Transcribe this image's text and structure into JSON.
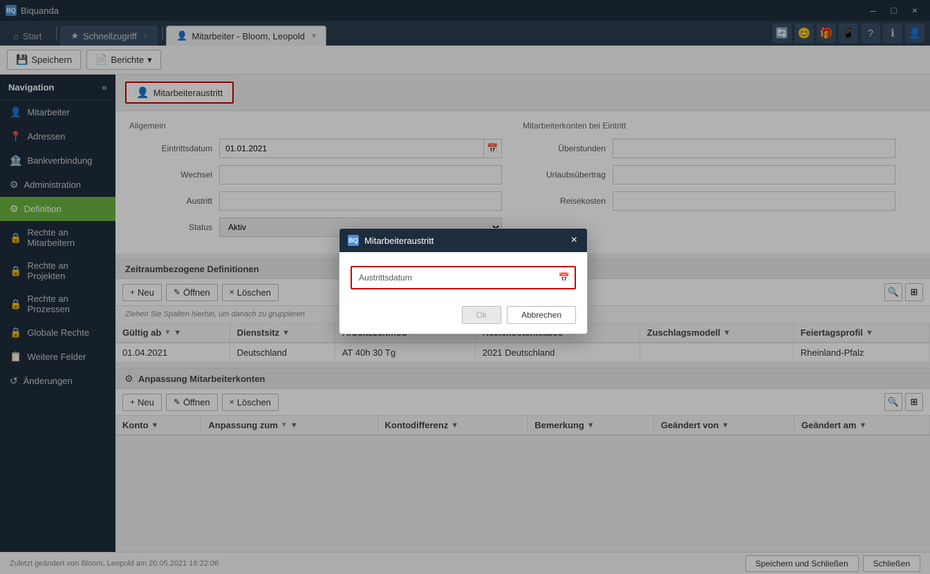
{
  "app": {
    "name": "Biquanda"
  },
  "titlebar": {
    "title": "Biquanda",
    "min": "–",
    "max": "□",
    "close": "×"
  },
  "tabs": [
    {
      "id": "start",
      "label": "Start",
      "icon": "⌂",
      "active": false,
      "pinned": false,
      "closable": false
    },
    {
      "id": "schnellzugriff",
      "label": "Schnellzugriff",
      "icon": "★",
      "active": false,
      "pinned": true,
      "closable": false
    },
    {
      "id": "mitarbeiter",
      "label": "Mitarbeiter - Bloom, Leopold",
      "icon": "👤",
      "active": true,
      "pinned": false,
      "closable": true
    }
  ],
  "toolbar": {
    "save_label": "Speichern",
    "reports_label": "Berichte"
  },
  "sidebar": {
    "title": "Navigation",
    "items": [
      {
        "id": "mitarbeiter",
        "label": "Mitarbeiter",
        "icon": "👤",
        "active": false
      },
      {
        "id": "adressen",
        "label": "Adressen",
        "icon": "📍",
        "active": false
      },
      {
        "id": "bankverbindung",
        "label": "Bankverbindung",
        "icon": "🏦",
        "active": false
      },
      {
        "id": "administration",
        "label": "Administration",
        "icon": "⚙",
        "active": false
      },
      {
        "id": "definition",
        "label": "Definition",
        "icon": "⚙",
        "active": true
      },
      {
        "id": "rechte-mitarbeiter",
        "label": "Rechte an Mitarbeitern",
        "icon": "🔒",
        "active": false
      },
      {
        "id": "rechte-projekte",
        "label": "Rechte an Projekten",
        "icon": "🔒",
        "active": false
      },
      {
        "id": "rechte-prozessen",
        "label": "Rechte an Prozessen",
        "icon": "🔒",
        "active": false
      },
      {
        "id": "globale-rechte",
        "label": "Globale Rechte",
        "icon": "🔒",
        "active": false
      },
      {
        "id": "weitere-felder",
        "label": "Weitere Felder",
        "icon": "📋",
        "active": false
      },
      {
        "id": "aenderungen",
        "label": "Änderungen",
        "icon": "↺",
        "active": false
      }
    ]
  },
  "content": {
    "action_button": "Mitarbeiteraustritt",
    "general_title": "Allgemein",
    "employee_accounts_title": "Mitarbeiterkonten bei Eintritt",
    "fields": {
      "eintrittsdatum_label": "Eintrittsdatum",
      "eintrittsdatum_value": "01.01.2021",
      "wechsel_label": "Wechsel",
      "austritt_label": "Austritt",
      "status_label": "Status",
      "status_value": "Aktiv",
      "ueberstunden_label": "Überstunden",
      "urlaubsuebertrag_label": "Urlaubsübertrag",
      "reisekosten_label": "Reisekosten"
    },
    "zeitraum_title": "Zeitraumbezogene Definitionen",
    "table_buttons": {
      "neu": "+ Neu",
      "oeffnen": "Öffnen",
      "loeschen": "Löschen"
    },
    "group_hint": "Ziehen Sie Spalten hierhin, um danach zu gruppieren",
    "table_columns": [
      {
        "label": "Gültig ab",
        "sortable": true,
        "filter": true
      },
      {
        "label": "Dienstsitz",
        "sortable": false,
        "filter": true
      },
      {
        "label": "Arbeitszeitmod",
        "sortable": false,
        "filter": true
      },
      {
        "label": "Resiekostenklasse",
        "sortable": false,
        "filter": true
      },
      {
        "label": "Zuschlagsmodell",
        "sortable": false,
        "filter": true
      },
      {
        "label": "Feiertagsprofil",
        "sortable": false,
        "filter": true
      }
    ],
    "table_rows": [
      {
        "gueltig_ab": "01.04.2021",
        "dienstsitz": "Deutschland",
        "arbeitszeitmod": "AT 40h 30 Tg",
        "reisekostenklasse": "2021 Deutschland",
        "zuschlagsmodell": "",
        "feiertagsprofil": "Rheinland-Pfalz"
      }
    ],
    "anpassung_title": "Anpassung Mitarbeiterkonten",
    "anpassung_columns": [
      {
        "label": "Konto",
        "filter": true
      },
      {
        "label": "Anpassung zum",
        "filter": true
      },
      {
        "label": "Kontodifferenz",
        "filter": true
      },
      {
        "label": "Bemerkung",
        "filter": true
      },
      {
        "label": "Geändert von",
        "filter": true
      },
      {
        "label": "Geändert am",
        "filter": true
      }
    ]
  },
  "modal": {
    "title": "Mitarbeiteraustritt",
    "close_btn": "×",
    "logo_text": "BQ",
    "field_label": "Austrittsdatum",
    "field_placeholder": "",
    "ok_label": "Ok",
    "cancel_label": "Abbrechen"
  },
  "statusbar": {
    "text": "Zuletzt geändert von Bloom, Leopold am 20.05.2021 16:22:06",
    "save_close": "Speichern und Schließen",
    "close": "Schließen"
  }
}
